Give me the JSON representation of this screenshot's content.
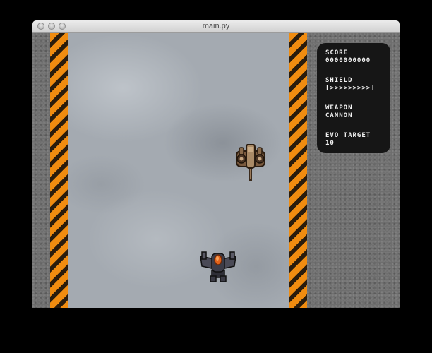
{
  "window": {
    "title": "main.py"
  },
  "hud": {
    "score_label": "SCORE",
    "score_value": "0000000000",
    "shield_label": "SHIELD",
    "shield_value": "[>>>>>>>>>]",
    "weapon_label": "WEAPON",
    "weapon_value": "CANNON",
    "evo_label": "EVO TARGET",
    "evo_value": "10"
  },
  "colors": {
    "hazard_orange": "#f08c10",
    "hazard_dark": "#2a1c0c",
    "hud_bg": "#161616",
    "sky": "#a4aab1"
  }
}
